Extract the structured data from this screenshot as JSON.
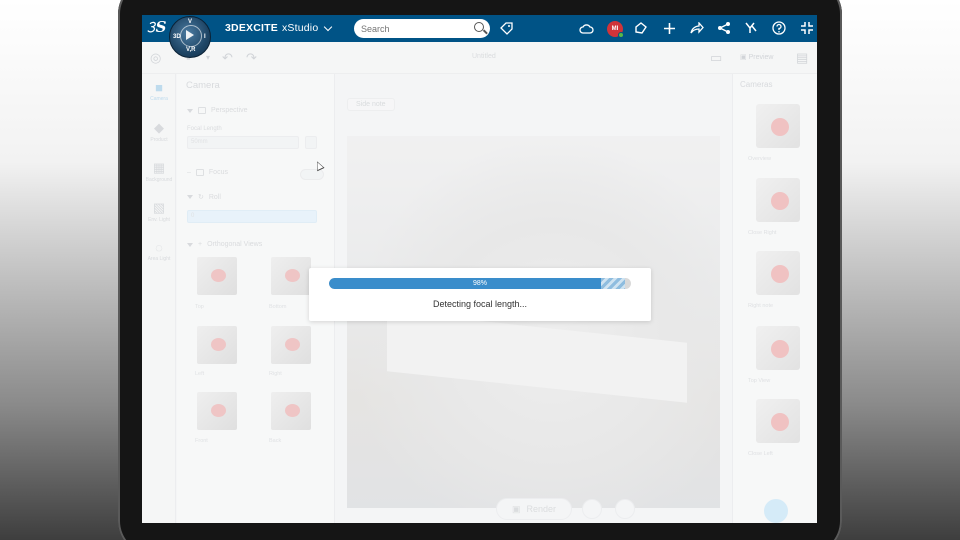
{
  "topbar": {
    "brand_bold": "3DEXCITE",
    "brand_app": "xStudio",
    "compass_top": "V",
    "compass_left": "3D",
    "compass_right": "I",
    "compass_bottom": "V,R",
    "search_placeholder": "Search",
    "avatar_initials": "MI",
    "icons": [
      "tag-icon",
      "cloud-icon",
      "avatar",
      "share-note-icon",
      "plus-icon",
      "share-icon",
      "network-icon",
      "3dswym-icon",
      "help-icon",
      "fullscreen-icon"
    ],
    "bar_color": "#005386"
  },
  "toolbar": {
    "view_label": "Untitled",
    "preview_label": "Preview"
  },
  "rail": {
    "items": [
      {
        "label": "Camera"
      },
      {
        "label": "Product"
      },
      {
        "label": "Background"
      },
      {
        "label": "Env. Light"
      },
      {
        "label": "Area Light"
      }
    ]
  },
  "panel": {
    "title": "Camera",
    "perspective": "Perspective",
    "focal_length_label": "Focal Length",
    "focal_value": "50mm",
    "focus": "Focus",
    "roll": "Roll",
    "roll_value": "0",
    "ortho": "Orthogonal Views",
    "thumbs": [
      "Top",
      "Bottom",
      "Left",
      "Right",
      "Front",
      "Back"
    ]
  },
  "viewport": {
    "side_tab": "Side note"
  },
  "right_panel": {
    "title": "Cameras",
    "items": [
      "Overview",
      "Close Right",
      "Right note",
      "Top View",
      "Close Left"
    ]
  },
  "bottom": {
    "render_label": "Render"
  },
  "progress": {
    "percent_text": "98%",
    "percent_value": 98,
    "message": "Detecting focal length...",
    "color": "#3a8dcb"
  }
}
